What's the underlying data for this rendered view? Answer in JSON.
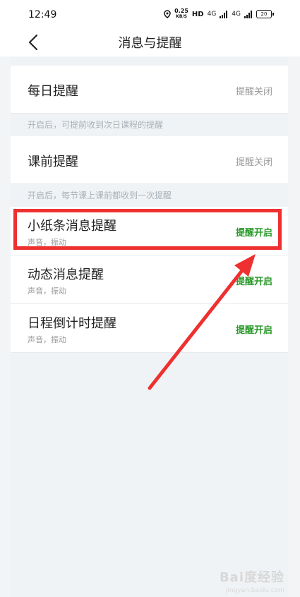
{
  "status_bar": {
    "time": "12:49",
    "speed_value": "0.25",
    "speed_unit": "KB/S",
    "hd": "HD",
    "network1": "4G",
    "network2": "4G",
    "battery": "20"
  },
  "header": {
    "title": "消息与提醒",
    "back_icon": "chevron-left-icon"
  },
  "settings": {
    "daily": {
      "title": "每日提醒",
      "status": "提醒关闭",
      "hint": "开启后，可提前收到次日课程的提醒"
    },
    "before_class": {
      "title": "课前提醒",
      "status": "提醒关闭",
      "hint": "开启后，每节课上课前都收到一次提醒"
    },
    "note": {
      "title": "小纸条消息提醒",
      "subtitle": "声音，振动",
      "status": "提醒开启"
    },
    "dynamic": {
      "title": "动态消息提醒",
      "subtitle": "声音，振动",
      "status": "提醒开启"
    },
    "countdown": {
      "title": "日程倒计时提醒",
      "subtitle": "声音，振动",
      "status": "提醒开启"
    }
  },
  "colors": {
    "enabled": "#2a9a2a",
    "disabled": "#9a9a9a",
    "highlight": "#ee3030"
  },
  "watermark": {
    "logo": "Bai度经验",
    "url": "jingyan.baidu.com"
  }
}
